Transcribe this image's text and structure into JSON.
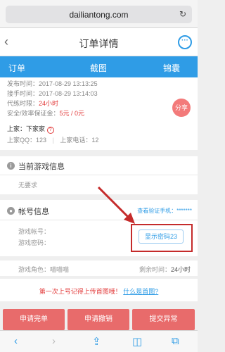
{
  "browser": {
    "url": "dailiantong.com",
    "reload_icon": "reload-icon"
  },
  "nav": {
    "back": "‹",
    "title": "订单详情",
    "chat_icon": "chat-bubble-icon"
  },
  "tabs": [
    "订单",
    "截图",
    "锦囊"
  ],
  "order": {
    "publish_time": "发布时间：2017-08-29 13:13:25",
    "accept_time": "接手时间：2017-08-29 13:14:03",
    "duration_label": "代练时限：",
    "duration_value": "24小时",
    "deposit_label": "安全/效率保证金：",
    "deposit_value": "5元 / 0元",
    "owner_label": "上家：",
    "owner_value": "下家家",
    "owner_qq": "上家QQ：123",
    "owner_phone": "上家电话：12",
    "share": "分享"
  },
  "game_info": {
    "title": "当前游戏信息",
    "content": "无要求"
  },
  "account": {
    "title": "帐号信息",
    "phone_link": "查看验证手机：*******",
    "account_label": "游戏帐号：",
    "password_label": "游戏密码：",
    "show_button": "显示密码23"
  },
  "role": {
    "role_label": "游戏角色：",
    "role_value": "喵喵喵",
    "remaining_label": "剩余时间：",
    "remaining_value": "24小时"
  },
  "notice": {
    "text": "第一次上号记得上传首图哦！",
    "link": "什么是首图?"
  },
  "actions": [
    "申请完单",
    "申请撤销",
    "提交异常"
  ],
  "toolbar": [
    "back-icon",
    "forward-icon",
    "share-icon",
    "bookmarks-icon",
    "tabs-icon"
  ],
  "colors": {
    "accent": "#2f9ce6",
    "danger": "#e23b3b",
    "button": "#e86b6b"
  }
}
